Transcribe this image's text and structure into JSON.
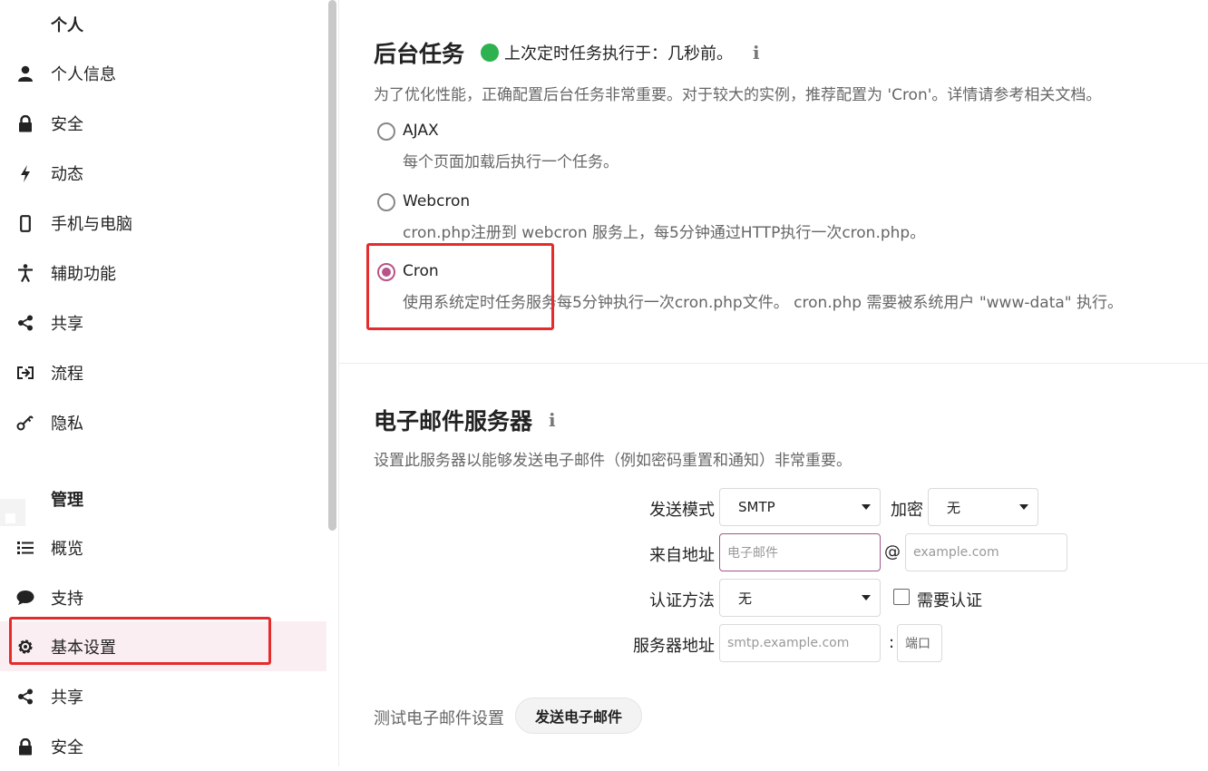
{
  "sidebar": {
    "personal_title": "个人",
    "personal_items": [
      {
        "label": "个人信息",
        "icon": "user-icon"
      },
      {
        "label": "安全",
        "icon": "lock-icon"
      },
      {
        "label": "动态",
        "icon": "lightning-icon"
      },
      {
        "label": "手机与电脑",
        "icon": "phone-icon"
      },
      {
        "label": "辅助功能",
        "icon": "accessibility-icon"
      },
      {
        "label": "共享",
        "icon": "share-icon"
      },
      {
        "label": "流程",
        "icon": "flow-icon"
      },
      {
        "label": "隐私",
        "icon": "key-icon"
      }
    ],
    "admin_title": "管理",
    "admin_items": [
      {
        "label": "概览",
        "icon": "list-icon"
      },
      {
        "label": "支持",
        "icon": "chat-icon"
      },
      {
        "label": "基本设置",
        "icon": "gear-icon",
        "active": true
      },
      {
        "label": "共享",
        "icon": "share-icon"
      },
      {
        "label": "安全",
        "icon": "lock-icon"
      }
    ]
  },
  "background_jobs": {
    "title": "后台任务",
    "status": "上次定时任务执行于：几秒前。",
    "info_icon": "i",
    "description": "为了优化性能，正确配置后台任务非常重要。对于较大的实例，推荐配置为 'Cron'。详情请参考相关文档。",
    "options": [
      {
        "label": "AJAX",
        "desc": "每个页面加载后执行一个任务。",
        "checked": false
      },
      {
        "label": "Webcron",
        "desc": "cron.php注册到 webcron 服务上，每5分钟通过HTTP执行一次cron.php。",
        "checked": false
      },
      {
        "label": "Cron",
        "desc": "使用系统定时任务服务每5分钟执行一次cron.php文件。 cron.php 需要被系统用户 \"www-data\" 执行。",
        "checked": true
      }
    ]
  },
  "email": {
    "title": "电子邮件服务器",
    "info_icon": "i",
    "description": "设置此服务器以能够发送电子邮件（例如密码重置和通知）非常重要。",
    "send_mode_label": "发送模式",
    "send_mode_value": "SMTP",
    "encryption_label": "加密",
    "encryption_value": "无",
    "from_label": "来自地址",
    "from_placeholder": "电子邮件",
    "at_sign": "@",
    "domain_placeholder": "example.com",
    "auth_label": "认证方法",
    "auth_value": "无",
    "auth_required_label": "需要认证",
    "server_label": "服务器地址",
    "server_placeholder": "smtp.example.com",
    "colon": ":",
    "port_placeholder": "端口",
    "test_label": "测试电子邮件设置",
    "send_button": "发送电子邮件"
  },
  "colors": {
    "accent": "#b8538a",
    "status_ok": "#2db24f",
    "highlight": "#e52b2b",
    "active_bg": "#fbeef3"
  }
}
